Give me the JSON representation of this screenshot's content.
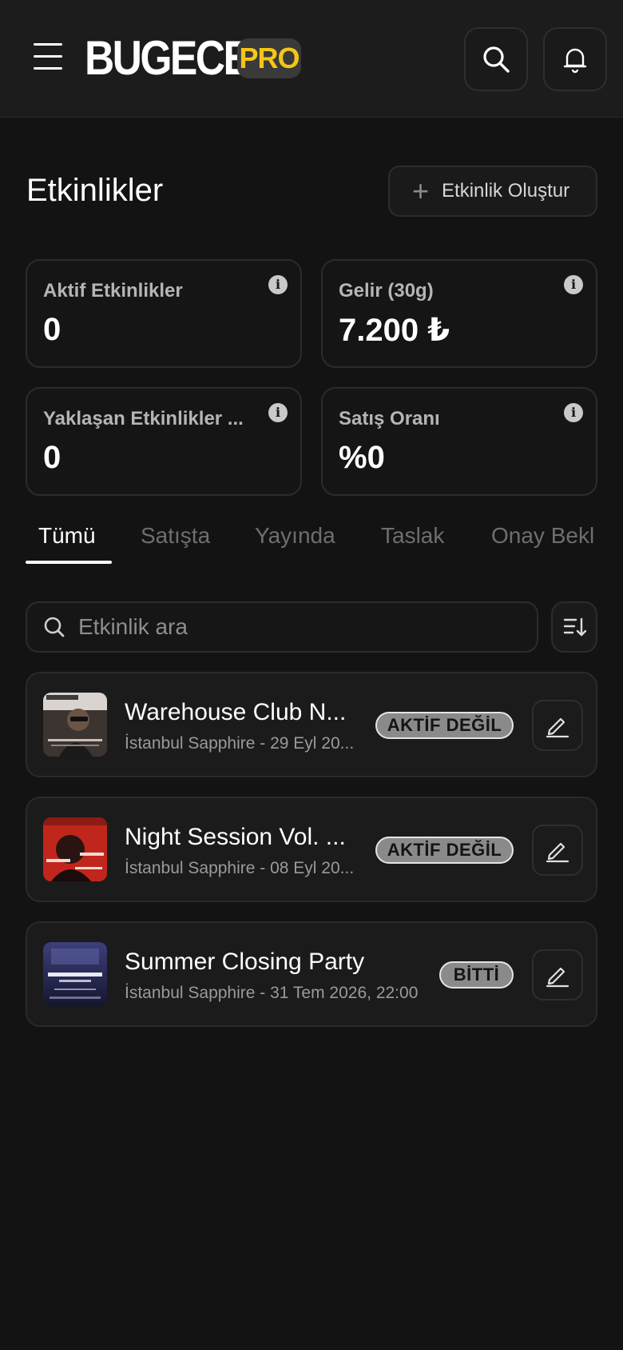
{
  "header": {
    "logo": "BUGECE",
    "badge": "PRO",
    "menu_icon": "hamburger-menu-icon",
    "search_icon": "search-icon",
    "bell_icon": "bell-icon",
    "accent_color": "#f5c518"
  },
  "page": {
    "title": "Etkinlikler",
    "create_label": "Etkinlik Oluştur"
  },
  "stats": [
    {
      "label": "Aktif Etkinlikler",
      "value": "0"
    },
    {
      "label": "Gelir (30g)",
      "value": "7.200 ₺"
    },
    {
      "label": "Yaklaşan Etkinlikler ...",
      "value": "0"
    },
    {
      "label": "Satış Oranı",
      "value": "%0"
    }
  ],
  "tabs": [
    {
      "label": "Tümü",
      "active": true
    },
    {
      "label": "Satışta"
    },
    {
      "label": "Yayında"
    },
    {
      "label": "Taslak"
    },
    {
      "label": "Onay Bekl"
    }
  ],
  "search": {
    "placeholder": "Etkinlik ara"
  },
  "events": [
    {
      "title": "Warehouse Club N...",
      "subtitle": "İstanbul Sapphire - 29 Eyl 20...",
      "status": "AKTİF DEĞİL"
    },
    {
      "title": "Night Session Vol. ...",
      "subtitle": "İstanbul Sapphire - 08 Eyl 20...",
      "status": "AKTİF DEĞİL"
    },
    {
      "title": "Summer Closing Party",
      "subtitle": "İstanbul Sapphire - 31 Tem 2026, 22:00",
      "status": "BİTTİ"
    }
  ]
}
